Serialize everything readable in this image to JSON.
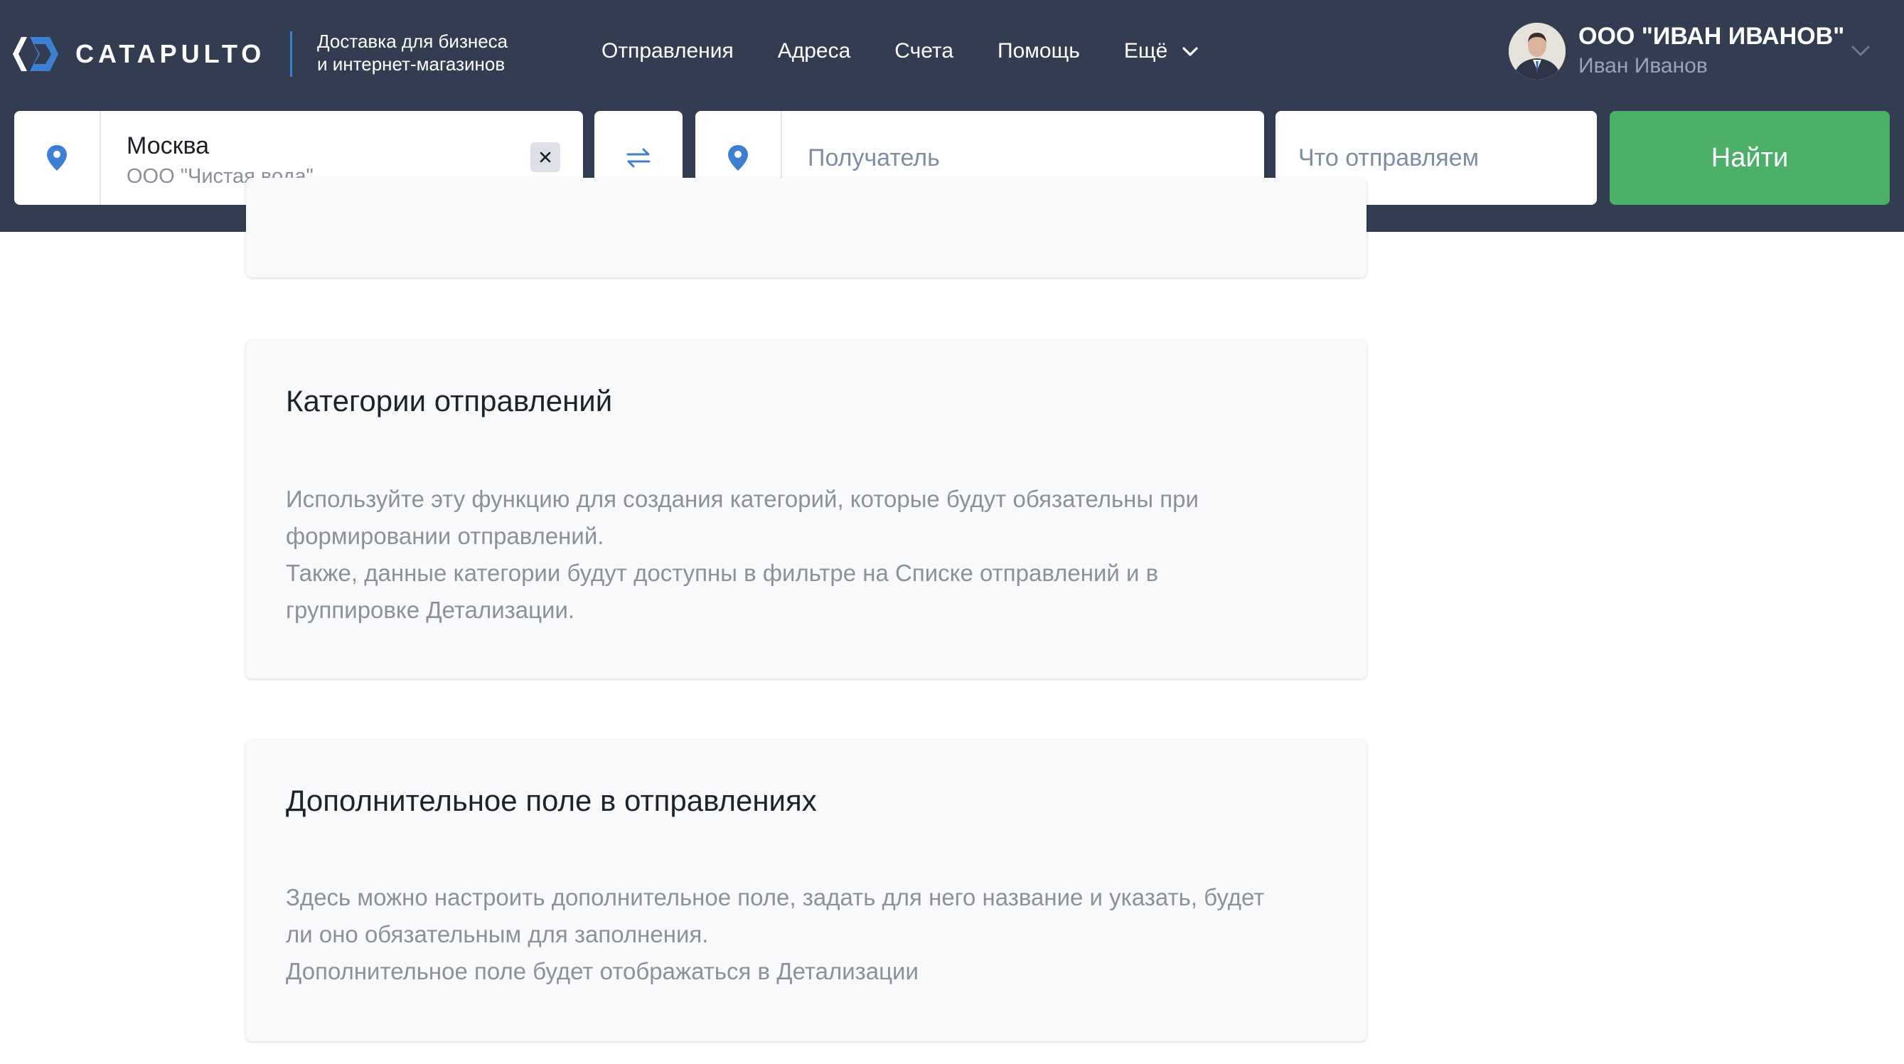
{
  "header": {
    "logo_text": "CATAPULTO",
    "tagline_line1": "Доставка для бизнеса",
    "tagline_line2": "и интернет-магазинов",
    "nav": [
      {
        "label": "Отправления"
      },
      {
        "label": "Адреса"
      },
      {
        "label": "Счета"
      },
      {
        "label": "Помощь"
      },
      {
        "label": "Ещё"
      }
    ],
    "profile": {
      "company": "ООО \"ИВАН ИВАНОВ\"",
      "user": "Иван Иванов"
    }
  },
  "search": {
    "sender_city": "Москва",
    "sender_org": "ООО \"Чистая вода\"",
    "receiver_placeholder": "Получатель",
    "what_placeholder": "Что отправляем",
    "find_label": "Найти"
  },
  "cards": [
    {
      "title": "Категории отправлений",
      "lines": [
        "Используйте эту функцию для создания категорий, которые будут обязательны при",
        "формировании отправлений.",
        "Также, данные категории будут доступны в фильтре на Списке отправлений и в",
        "группировке Детализации."
      ]
    },
    {
      "title": "Дополнительное поле в отправлениях",
      "lines": [
        "Здесь можно настроить дополнительное поле, задать для него название и указать, будет",
        "ли оно обязательным для заполнения.",
        "Дополнительное поле будет отображаться в Детализации"
      ]
    }
  ],
  "colors": {
    "header_bg": "#333d51",
    "accent_blue": "#3d7fd1",
    "find_green": "#4caf68"
  },
  "icons": {
    "logo": "catapulto-logo-icon",
    "pin": "location-pin-icon",
    "clear": "close-icon",
    "swap": "swap-arrows-icon",
    "chevron": "chevron-down-icon"
  }
}
